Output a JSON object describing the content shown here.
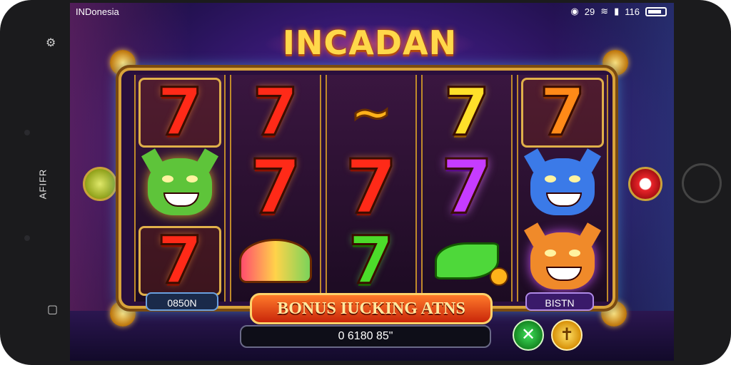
{
  "status_bar": {
    "carrier": "INDonesia",
    "right_a": "29",
    "right_b": "116"
  },
  "phone": {
    "side_label": "AFIFR"
  },
  "game": {
    "title": "INCADAN",
    "bonus_banner": "BONUS IUCKING ATNS",
    "left_value": "0850N",
    "right_value": "BISTN",
    "balance": "0 6180 85\""
  },
  "reels": [
    {
      "symbols": [
        "7",
        "goblin-green",
        "7"
      ]
    },
    {
      "symbols": [
        "7",
        "7",
        "fan"
      ]
    },
    {
      "symbols": [
        "~",
        "7",
        "7"
      ]
    },
    {
      "symbols": [
        "7",
        "7",
        "leaf"
      ]
    },
    {
      "symbols": [
        "7",
        "goblin-blue",
        "goblin-orange"
      ]
    }
  ],
  "colors": {
    "frame_gold": "#d8a33a",
    "title_yellow": "#ffd84a",
    "banner_orange": "#ff7a2a",
    "background_purple": "#3a1a78"
  },
  "icons": {
    "spin_cancel": "close-icon",
    "spin_confirm": "cross-icon"
  }
}
